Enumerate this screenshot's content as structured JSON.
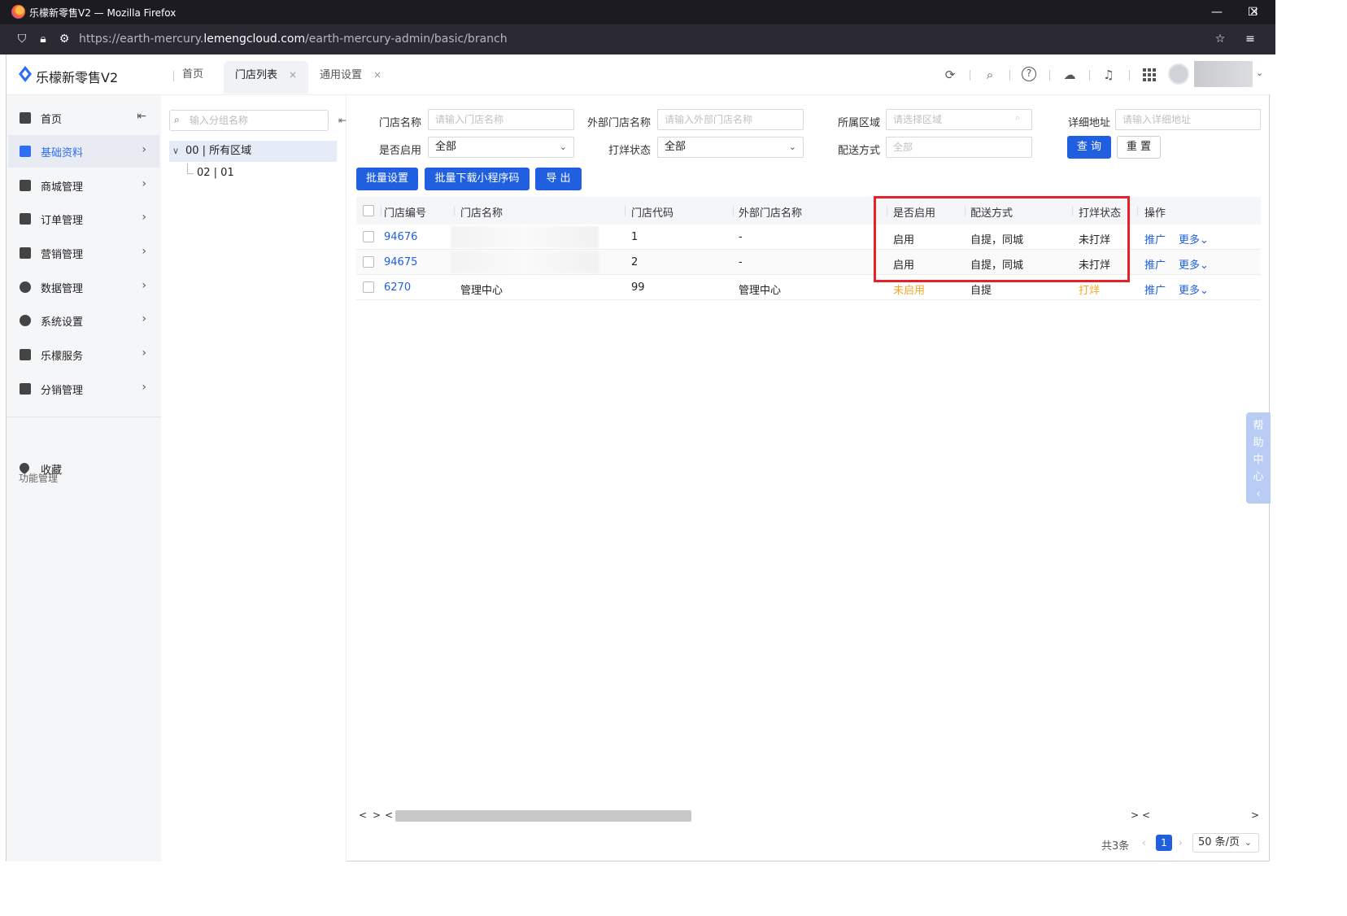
{
  "browser": {
    "window_title": "乐檬新零售V2 — Mozilla Firefox",
    "url_prefix": "https://earth-mercury.",
    "url_domain": "lemengcloud.com",
    "url_path": "/earth-mercury-admin/basic/branch",
    "min_symbol": "—",
    "max_symbol": "☐",
    "close_symbol": "✕"
  },
  "header": {
    "brand": "乐檬新零售V2",
    "tabs": [
      {
        "label": "首页"
      },
      {
        "label": "门店列表",
        "close": "×"
      },
      {
        "label": "通用设置",
        "close": "×"
      }
    ],
    "icons": [
      "refresh-icon",
      "search-icon",
      "help-icon",
      "cloud-download-icon",
      "bell-icon",
      "grid-apps-icon"
    ]
  },
  "sidebar": {
    "items": [
      {
        "label": "首页",
        "icon": "home-icon",
        "collapse": "⇤"
      },
      {
        "label": "基础资料",
        "icon": "cube-icon",
        "chev": "›"
      },
      {
        "label": "商城管理",
        "icon": "shop-icon",
        "chev": "›"
      },
      {
        "label": "订单管理",
        "icon": "order-icon",
        "chev": "›"
      },
      {
        "label": "营销管理",
        "icon": "chart-icon",
        "chev": "›"
      },
      {
        "label": "数据管理",
        "icon": "pie-icon",
        "chev": "›"
      },
      {
        "label": "系统设置",
        "icon": "settings-icon",
        "chev": "›"
      },
      {
        "label": "乐檬服务",
        "icon": "briefcase-icon",
        "chev": "›"
      },
      {
        "label": "分销管理",
        "icon": "box-icon",
        "chev": "›"
      }
    ],
    "section_label": "功能管理",
    "favorites": {
      "label": "收藏",
      "icon": "heart-icon"
    }
  },
  "tree": {
    "search_placeholder": "输入分组名称",
    "nodes": [
      {
        "label": "00 | 所有区域",
        "toggle": "∨"
      },
      {
        "label": "02 | 01"
      }
    ]
  },
  "filters": {
    "store_name": {
      "label": "门店名称",
      "placeholder": "请输入门店名称"
    },
    "external_name": {
      "label": "外部门店名称",
      "placeholder": "请输入外部门店名称"
    },
    "region": {
      "label": "所属区域",
      "placeholder": "请选择区域"
    },
    "address": {
      "label": "详细地址",
      "placeholder": "请输入详细地址"
    },
    "enabled": {
      "label": "是否启用",
      "value": "全部"
    },
    "print_status": {
      "label": "打烊状态",
      "value": "全部"
    },
    "delivery": {
      "label": "配送方式",
      "placeholder": "全部"
    },
    "query_button": "查 询",
    "reset_button": "重 置"
  },
  "actions": {
    "batch_settings": "批量设置",
    "batch_download_qr": "批量下载小程序码",
    "export": "导 出"
  },
  "table": {
    "columns": [
      "门店编号",
      "门店名称",
      "门店代码",
      "外部门店名称",
      "是否启用",
      "配送方式",
      "打烊状态",
      "操作"
    ],
    "rows": [
      {
        "id": "94676",
        "name": "",
        "code": "1",
        "external": "-",
        "enabled": "启用",
        "delivery": "自提，同城",
        "status": "未打烊",
        "promote": "推广",
        "more": "更多"
      },
      {
        "id": "94675",
        "name": "",
        "code": "2",
        "external": "-",
        "enabled": "启用",
        "delivery": "自提，同城",
        "status": "未打烊",
        "promote": "推广",
        "more": "更多"
      },
      {
        "id": "6270",
        "name": "管理中心",
        "code": "99",
        "external": "管理中心",
        "enabled": "未启用",
        "delivery": "自提",
        "status": "打烊",
        "promote": "推广",
        "more": "更多"
      }
    ]
  },
  "pager": {
    "total": "共3条",
    "current_page": "1",
    "page_size": "50 条/页",
    "prev": "‹",
    "next": "›"
  },
  "help_dock": [
    "帮",
    "助",
    "中",
    "心",
    "‹"
  ],
  "colors": {
    "primary": "#1f5fe0",
    "warning": "#f5a623",
    "highlight": "#e8202a"
  }
}
